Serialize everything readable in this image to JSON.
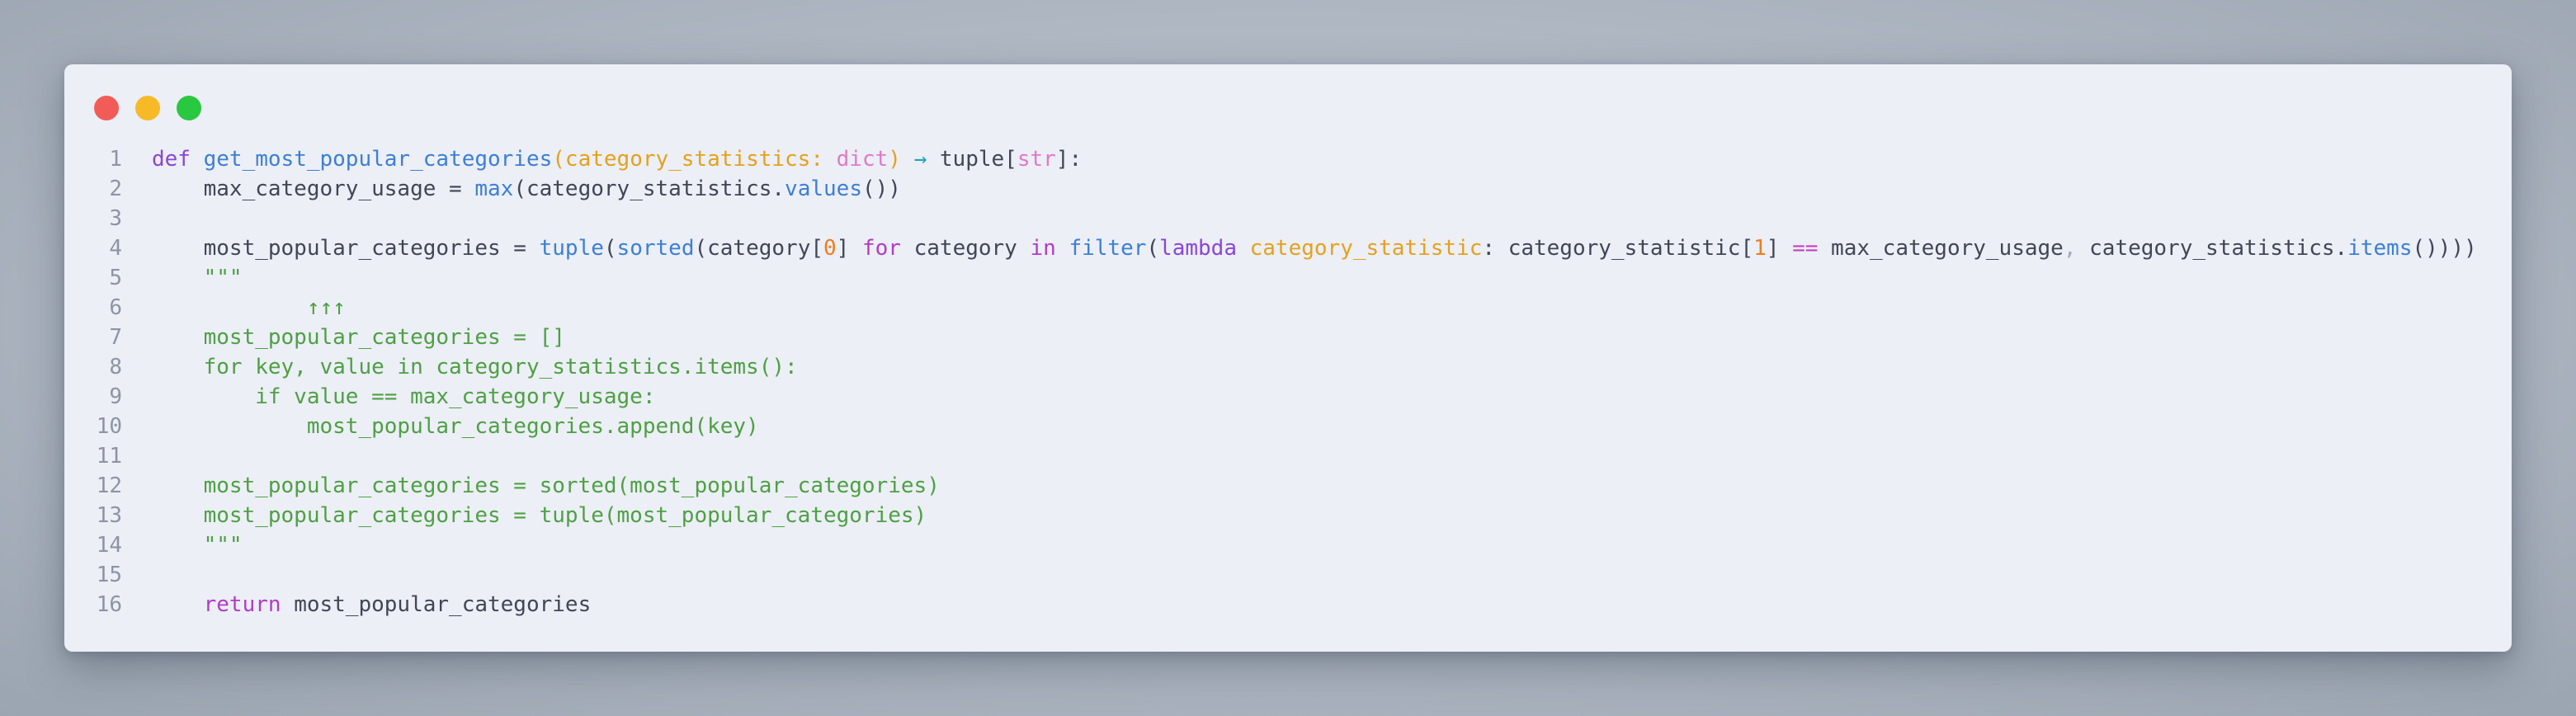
{
  "window": {
    "traffic_lights": [
      {
        "name": "close",
        "color": "#f25c58"
      },
      {
        "name": "minimize",
        "color": "#f8b928"
      },
      {
        "name": "maximize",
        "color": "#2ac840"
      }
    ],
    "background_color": "#eceff6"
  },
  "code": {
    "language": "python",
    "lines": [
      {
        "number": "1",
        "tokens": [
          {
            "t": "def",
            "c": "kw2"
          },
          {
            "t": " ",
            "c": "plain"
          },
          {
            "t": "get_most_popular_categories",
            "c": "fn"
          },
          {
            "t": "(",
            "c": "param"
          },
          {
            "t": "category_statistics",
            "c": "param"
          },
          {
            "t": ": ",
            "c": "param"
          },
          {
            "t": "dict",
            "c": "type"
          },
          {
            "t": ")",
            "c": "param"
          },
          {
            "t": " ",
            "c": "plain"
          },
          {
            "t": "→",
            "c": "arrow"
          },
          {
            "t": " tuple",
            "c": "plain"
          },
          {
            "t": "[",
            "c": "plain"
          },
          {
            "t": "str",
            "c": "type"
          },
          {
            "t": "]:",
            "c": "plain"
          }
        ]
      },
      {
        "number": "2",
        "tokens": [
          {
            "t": "    max_category_usage = ",
            "c": "plain"
          },
          {
            "t": "max",
            "c": "fn"
          },
          {
            "t": "(category_statistics.",
            "c": "plain"
          },
          {
            "t": "values",
            "c": "fn"
          },
          {
            "t": "())",
            "c": "plain"
          }
        ]
      },
      {
        "number": "3",
        "tokens": []
      },
      {
        "number": "4",
        "tokens": [
          {
            "t": "    most_popular_categories = ",
            "c": "plain"
          },
          {
            "t": "tuple",
            "c": "fn"
          },
          {
            "t": "(",
            "c": "plain"
          },
          {
            "t": "sorted",
            "c": "fn"
          },
          {
            "t": "(category[",
            "c": "plain"
          },
          {
            "t": "0",
            "c": "num"
          },
          {
            "t": "] ",
            "c": "plain"
          },
          {
            "t": "for",
            "c": "kw"
          },
          {
            "t": " category ",
            "c": "plain"
          },
          {
            "t": "in",
            "c": "kw"
          },
          {
            "t": " ",
            "c": "plain"
          },
          {
            "t": "filter",
            "c": "fn"
          },
          {
            "t": "(",
            "c": "plain"
          },
          {
            "t": "lambda",
            "c": "kw2"
          },
          {
            "t": " ",
            "c": "plain"
          },
          {
            "t": "category_statistic",
            "c": "param"
          },
          {
            "t": ": category_statistic[",
            "c": "plain"
          },
          {
            "t": "1",
            "c": "num"
          },
          {
            "t": "] ",
            "c": "plain"
          },
          {
            "t": "==",
            "c": "op"
          },
          {
            "t": " max_category_usage",
            "c": "plain"
          },
          {
            "t": ",",
            "c": "punc"
          },
          {
            "t": " category_statistics.",
            "c": "plain"
          },
          {
            "t": "items",
            "c": "fn"
          },
          {
            "t": "())))",
            "c": "plain"
          }
        ]
      },
      {
        "number": "5",
        "tokens": [
          {
            "t": "    \"\"\"",
            "c": "str"
          }
        ]
      },
      {
        "number": "6",
        "tokens": [
          {
            "t": "            ↑↑↑",
            "c": "str"
          }
        ]
      },
      {
        "number": "7",
        "tokens": [
          {
            "t": "    most_popular_categories = []",
            "c": "str"
          }
        ]
      },
      {
        "number": "8",
        "tokens": [
          {
            "t": "    for key, value in category_statistics.items():",
            "c": "str"
          }
        ]
      },
      {
        "number": "9",
        "tokens": [
          {
            "t": "        if value == max_category_usage:",
            "c": "str"
          }
        ]
      },
      {
        "number": "10",
        "tokens": [
          {
            "t": "            most_popular_categories.append(key)",
            "c": "str"
          }
        ]
      },
      {
        "number": "11",
        "tokens": []
      },
      {
        "number": "12",
        "tokens": [
          {
            "t": "    most_popular_categories = sorted(most_popular_categories)",
            "c": "str"
          }
        ]
      },
      {
        "number": "13",
        "tokens": [
          {
            "t": "    most_popular_categories = tuple(most_popular_categories)",
            "c": "str"
          }
        ]
      },
      {
        "number": "14",
        "tokens": [
          {
            "t": "    \"\"\"",
            "c": "str"
          }
        ]
      },
      {
        "number": "15",
        "tokens": []
      },
      {
        "number": "16",
        "tokens": [
          {
            "t": "    ",
            "c": "plain"
          },
          {
            "t": "return",
            "c": "kw"
          },
          {
            "t": " most_popular_categories",
            "c": "plain"
          }
        ]
      }
    ]
  }
}
